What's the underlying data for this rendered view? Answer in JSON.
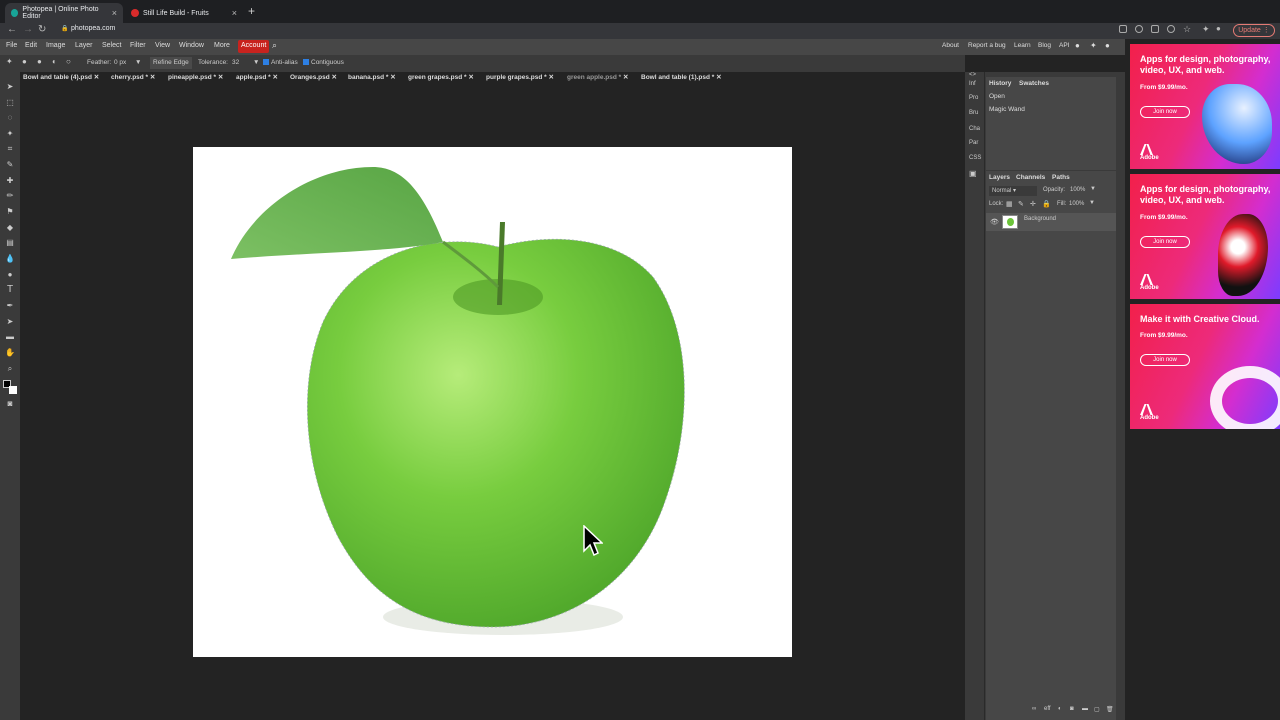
{
  "browser": {
    "tabs": [
      {
        "title": "Photopea | Online Photo Editor",
        "active": true
      },
      {
        "title": "Still Life Build - Fruits",
        "active": false
      }
    ],
    "url": "photopea.com",
    "update_label": "Update"
  },
  "menubar": {
    "items": [
      "File",
      "Edit",
      "Image",
      "Layer",
      "Select",
      "Filter",
      "View",
      "Window",
      "More"
    ],
    "account": "Account",
    "right": [
      "About",
      "Report a bug",
      "Learn",
      "Blog",
      "API"
    ]
  },
  "options": {
    "feather_label": "Feather:",
    "feather_value": "0 px",
    "refine_edge": "Refine Edge",
    "tolerance_label": "Tolerance:",
    "tolerance_value": "32",
    "anti_alias": "Anti-alias",
    "contiguous": "Contiguous"
  },
  "doc_tabs": [
    "Bowl and table (4).psd",
    "cherry.psd *",
    "pineapple.psd *",
    "apple.psd *",
    "Oranges.psd",
    "banana.psd *",
    "green grapes.psd *",
    "purple grapes.psd *",
    "green apple.psd *",
    "Bowl and table (1).psd *"
  ],
  "mini_panels": [
    "Inf",
    "Pro",
    "Bru",
    "Cha",
    "Par",
    "CSS"
  ],
  "history": {
    "tabs": [
      "History",
      "Swatches"
    ],
    "items": [
      "Open",
      "Magic Wand"
    ]
  },
  "layers": {
    "tabs": [
      "Layers",
      "Channels",
      "Paths"
    ],
    "blend_mode": "Normal",
    "opacity_label": "Opacity:",
    "opacity_value": "100%",
    "lock_label": "Lock:",
    "fill_label": "Fill:",
    "fill_value": "100%",
    "items": [
      {
        "name": "Background"
      }
    ]
  },
  "ads": [
    {
      "title": "Apps for design, photography, video, UX, and web.",
      "price": "From $9.99/mo.",
      "button": "Join now",
      "brand": "Adobe"
    },
    {
      "title": "Apps for design, photography, video, UX, and web.",
      "price": "From $9.99/mo.",
      "button": "Join now",
      "brand": "Adobe"
    },
    {
      "title": "Make it with Creative Cloud.",
      "price": "From $9.99/mo.",
      "button": "Join now",
      "brand": "Adobe"
    }
  ],
  "colors": {
    "accent": "#c8231e",
    "checkbox": "#2d7fe3",
    "apple_green": "#6cc43a"
  }
}
